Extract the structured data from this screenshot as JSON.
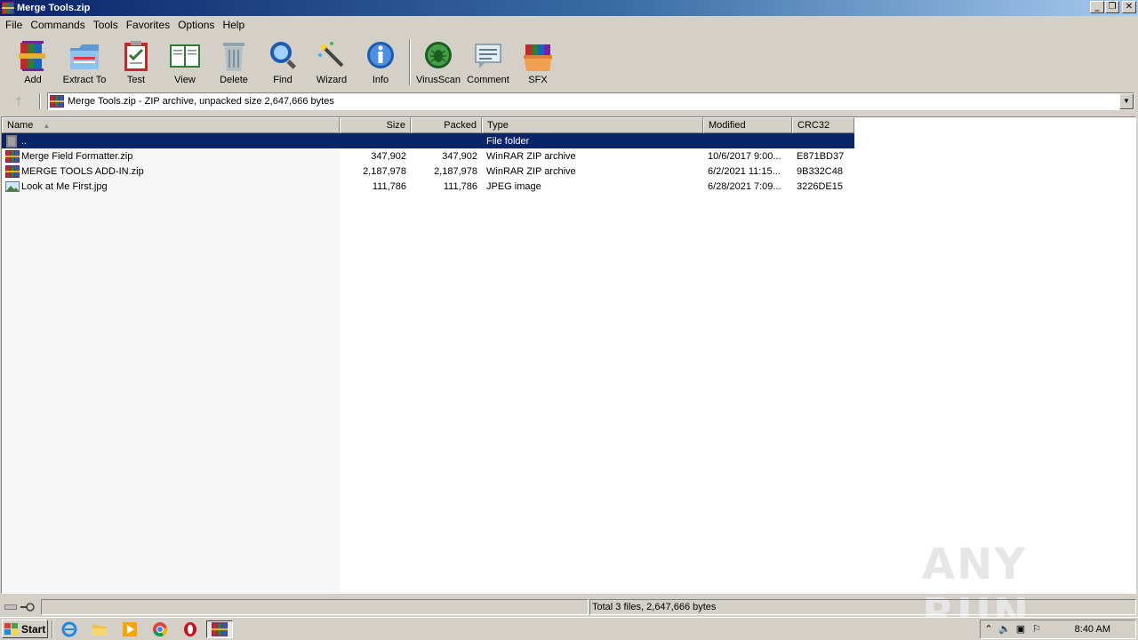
{
  "window": {
    "title": "Merge Tools.zip",
    "controls": [
      "_",
      "❐",
      "✕"
    ]
  },
  "menu": [
    "File",
    "Commands",
    "Tools",
    "Favorites",
    "Options",
    "Help"
  ],
  "toolbar": {
    "add": "Add",
    "extract_to": "Extract To",
    "test": "Test",
    "view": "View",
    "delete": "Delete",
    "find": "Find",
    "wizard": "Wizard",
    "info": "Info",
    "virusscan": "VirusScan",
    "comment": "Comment",
    "sfx": "SFX"
  },
  "address": {
    "text": "Merge Tools.zip - ZIP archive, unpacked size 2,647,666 bytes"
  },
  "columns": {
    "name": "Name",
    "size": "Size",
    "packed": "Packed",
    "type": "Type",
    "modified": "Modified",
    "crc32": "CRC32"
  },
  "files": [
    {
      "name": "..",
      "size": "",
      "packed": "",
      "type": "File folder",
      "modified": "",
      "crc": "",
      "icon": "folder-up-icon"
    },
    {
      "name": "Merge Field Formatter.zip",
      "size": "347,902",
      "packed": "347,902",
      "type": "WinRAR ZIP archive",
      "modified": "10/6/2017 9:00...",
      "crc": "E871BD37",
      "icon": "zip-icon"
    },
    {
      "name": "MERGE TOOLS ADD-IN.zip",
      "size": "2,187,978",
      "packed": "2,187,978",
      "type": "WinRAR ZIP archive",
      "modified": "6/2/2021 11:15...",
      "crc": "9B332C48",
      "icon": "zip-icon"
    },
    {
      "name": "Look at Me First.jpg",
      "size": "111,786",
      "packed": "111,786",
      "type": "JPEG image",
      "modified": "6/28/2021 7:09...",
      "crc": "3226DE15",
      "icon": "image-icon"
    }
  ],
  "status": {
    "left": "",
    "total": "Total 3 files, 2,647,666 bytes"
  },
  "taskbar": {
    "start": "Start",
    "clock": "8:40 AM"
  },
  "watermark": "ANY RUN",
  "colors": {
    "selection": "#0a246a",
    "titlebar": "#0a246a",
    "face": "#d4d0c8"
  }
}
